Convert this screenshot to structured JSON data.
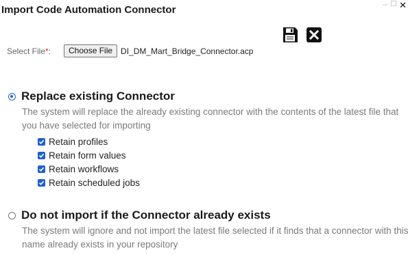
{
  "window": {
    "title": "Import Code Automation Connector",
    "close_glyph": "✕"
  },
  "toolbar": {
    "save_icon": "floppy-disk-icon",
    "cancel_icon": "close-box-icon"
  },
  "file_select": {
    "label": "Select File",
    "required_marker": "*",
    "colon": ":",
    "button_label": "Choose File",
    "file_name": "DI_DM_Mart_Bridge_Connector.acp"
  },
  "options": {
    "replace": {
      "selected": true,
      "title": "Replace existing Connector",
      "description": "The system will replace the already existing connector with the contents of the latest file that you have selected for importing",
      "retain": [
        {
          "label": "Retain profiles",
          "checked": true
        },
        {
          "label": "Retain form values",
          "checked": true
        },
        {
          "label": "Retain workflows",
          "checked": true
        },
        {
          "label": "Retain scheduled jobs",
          "checked": true
        }
      ]
    },
    "skip": {
      "selected": false,
      "title": "Do not import if the Connector already exists",
      "description": "The system will ignore and not import the latest file selected if it finds that a connector with this name already exists in your repository"
    }
  },
  "colors": {
    "accent": "#1f5fd1",
    "required": "#d9262e",
    "muted_text": "#7a7a7a"
  }
}
